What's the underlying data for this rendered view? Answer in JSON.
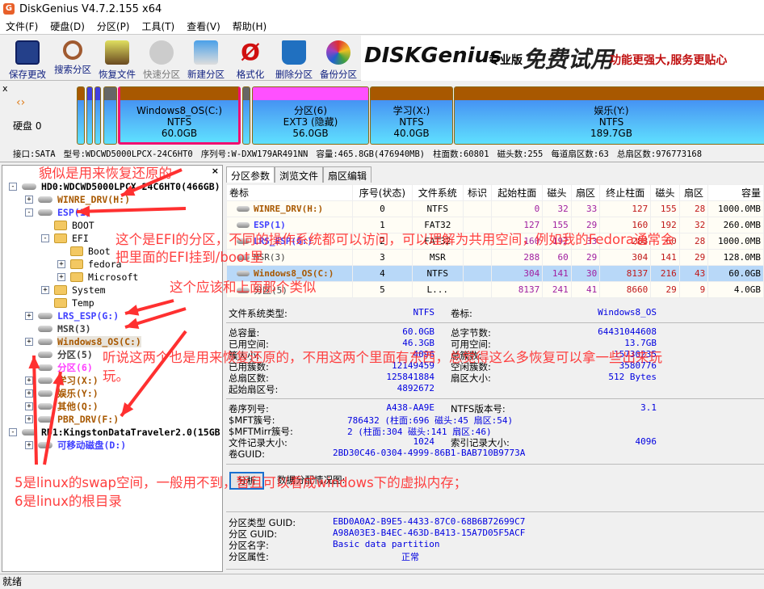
{
  "window": {
    "title": "DiskGenius V4.7.2.155 x64"
  },
  "menu": [
    "文件(F)",
    "硬盘(D)",
    "分区(P)",
    "工具(T)",
    "查看(V)",
    "帮助(H)"
  ],
  "toolbar": [
    {
      "label": "保存更改",
      "icon": "save-icon"
    },
    {
      "label": "搜索分区",
      "icon": "search-icon"
    },
    {
      "label": "恢复文件",
      "icon": "recover-icon"
    },
    {
      "label": "快速分区",
      "icon": "disc-icon"
    },
    {
      "label": "新建分区",
      "icon": "laptop-icon"
    },
    {
      "label": "格式化",
      "icon": "format-icon"
    },
    {
      "label": "删除分区",
      "icon": "trash-icon"
    },
    {
      "label": "备份分区",
      "icon": "backup-icon"
    }
  ],
  "banner": {
    "brand": "DISKGenius",
    "edition": "专业版",
    "promo": "免费试用",
    "slogan": "功能更强大,服务更贴心"
  },
  "diskmap": {
    "disk_label": "硬盘 0",
    "partitions": [
      {
        "name": "Windows8_OS(C:)",
        "fs": "NTFS",
        "size": "60.0GB"
      },
      {
        "name": "分区(6)",
        "fs": "EXT3 (隐藏)",
        "size": "56.0GB"
      },
      {
        "name": "学习(X:)",
        "fs": "NTFS",
        "size": "40.0GB"
      },
      {
        "name": "娱乐(Y:)",
        "fs": "NTFS",
        "size": "189.7GB"
      }
    ]
  },
  "diskinfo": [
    "接口:SATA",
    "型号:WDCWD5000LPCX-24C6HT0",
    "序列号:W-DXW179AR491NN",
    "容量:465.8GB(476940MB)",
    "柱面数:60801",
    "磁头数:255",
    "每道扇区数:63",
    "总扇区数:976773168"
  ],
  "tree": [
    {
      "label": "HD0:WDCWD5000LPCX-24C6HT0(466GB)",
      "color": "#000000"
    },
    {
      "label": "WINRE_DRV(H:)",
      "color": "#a85800"
    },
    {
      "label": "ESP(1)",
      "color": "#4040ff"
    },
    {
      "label": "BOOT"
    },
    {
      "label": "EFI"
    },
    {
      "label": "Boot"
    },
    {
      "label": "fedora"
    },
    {
      "label": "Microsoft"
    },
    {
      "label": "System"
    },
    {
      "label": "Temp"
    },
    {
      "label": "LRS_ESP(G:)",
      "color": "#4040ff"
    },
    {
      "label": "MSR(3)",
      "color": "#404040"
    },
    {
      "label": "Windows8_OS(C:)",
      "color": "#a85800"
    },
    {
      "label": "分区(5)",
      "color": "#404040"
    },
    {
      "label": "分区(6)",
      "color": "#ff40ff"
    },
    {
      "label": "学习(X:)",
      "color": "#a85800"
    },
    {
      "label": "娱乐(Y:)",
      "color": "#a85800"
    },
    {
      "label": "其他(Q:)",
      "color": "#a85800"
    },
    {
      "label": "PBR_DRV(F:)",
      "color": "#a85800"
    },
    {
      "label": "RD1:KingstonDataTraveler2.0(15GB",
      "color": "#000000"
    },
    {
      "label": "可移动磁盘(D:)",
      "color": "#4040ff"
    }
  ],
  "tabs": [
    "分区参数",
    "浏览文件",
    "扇区编辑"
  ],
  "table": {
    "headers": [
      "卷标",
      "序号(状态)",
      "文件系统",
      "标识",
      "起始柱面",
      "磁头",
      "扇区",
      "终止柱面",
      "磁头",
      "扇区",
      "容量"
    ],
    "rows": [
      [
        "WINRE_DRV(H:)",
        "0",
        "NTFS",
        "",
        "0",
        "32",
        "33",
        "127",
        "155",
        "28",
        "1000.0MB"
      ],
      [
        "ESP(1)",
        "1",
        "FAT32",
        "",
        "127",
        "155",
        "29",
        "160",
        "192",
        "32",
        "260.0MB"
      ],
      [
        "LRS_ESP(G:)",
        "2",
        "FAT32",
        "",
        "160",
        "192",
        "33",
        "288",
        "60",
        "28",
        "1000.0MB"
      ],
      [
        "MSR(3)",
        "3",
        "MSR",
        "",
        "288",
        "60",
        "29",
        "304",
        "141",
        "29",
        "128.0MB"
      ],
      [
        "Windows8_OS(C:)",
        "4",
        "NTFS",
        "",
        "304",
        "141",
        "30",
        "8137",
        "216",
        "43",
        "60.0GB"
      ],
      [
        "分区(5)",
        "5",
        "L...",
        "",
        "8137",
        "241",
        "41",
        "8660",
        "29",
        "9",
        "4.0GB"
      ]
    ]
  },
  "details": {
    "fs_type_label": "文件系统类型:",
    "fs_type": "NTFS",
    "vol_label_label": "卷标:",
    "vol_label": "Windows8_OS",
    "grid1": [
      [
        "总容量:",
        "60.0GB",
        "总字节数:",
        "64431044608"
      ],
      [
        "已用空间:",
        "46.3GB",
        "可用空间:",
        "13.7GB"
      ],
      [
        "簇大小:",
        "4096",
        "总簇数:",
        "15730235"
      ],
      [
        "已用簇数:",
        "12149459",
        "空闲簇数:",
        "3580776"
      ],
      [
        "总扇区数:",
        "125841884",
        "扇区大小:",
        "512 Bytes"
      ],
      [
        "起始扇区号:",
        "4892672",
        "",
        ""
      ]
    ],
    "grid2": [
      [
        "卷序列号:",
        "A438-AA9E",
        "NTFS版本号:",
        "3.1"
      ],
      [
        "$MFT簇号:",
        "786432 (柱面:696 磁头:45 扇区:54)",
        "",
        ""
      ],
      [
        "$MFTMirr簇号:",
        "2 (柱面:304 磁头:141 扇区:46)",
        "",
        ""
      ],
      [
        "文件记录大小:",
        "1024",
        "索引记录大小:",
        "4096"
      ]
    ],
    "guid_label": "卷GUID:",
    "guid": "2BD30C46-0304-4999-86B1-BAB710B9773A",
    "analyze_button": "分析",
    "alloc_label": "数据分配情况图:",
    "gpt": [
      [
        "分区类型 GUID:",
        "EBD0A0A2-B9E5-4433-87C0-68B6B72699C7"
      ],
      [
        "分区 GUID:",
        "A98A03E3-B4EC-463D-B413-15A7D05F5ACF"
      ],
      [
        "分区名字:",
        "Basic data partition"
      ],
      [
        "分区属性:",
        "正常"
      ]
    ]
  },
  "status": "就绪",
  "annotations": [
    "貌似是用来恢复还原的",
    "这个是EFI的分区，不同的操作系统都可以访问，可以理解为共用空间，例如我的Fedora通常会",
    "把里面的EFI挂到/boot里",
    "这个应该和上面那个类似",
    "听说这两个也是用来恢复还原的，不用这两个里面有东西，总觉得这么多恢复可以拿一些出来玩",
    "玩。",
    "5是linux的swap空间，一般用不到，暂且可以看成windows下的虚拟内存；",
    "6是linux的根目录"
  ],
  "colors": {
    "annotation": "#ff3030",
    "selected_row": "#b8d8f8",
    "value_blue": "#0000e0"
  }
}
